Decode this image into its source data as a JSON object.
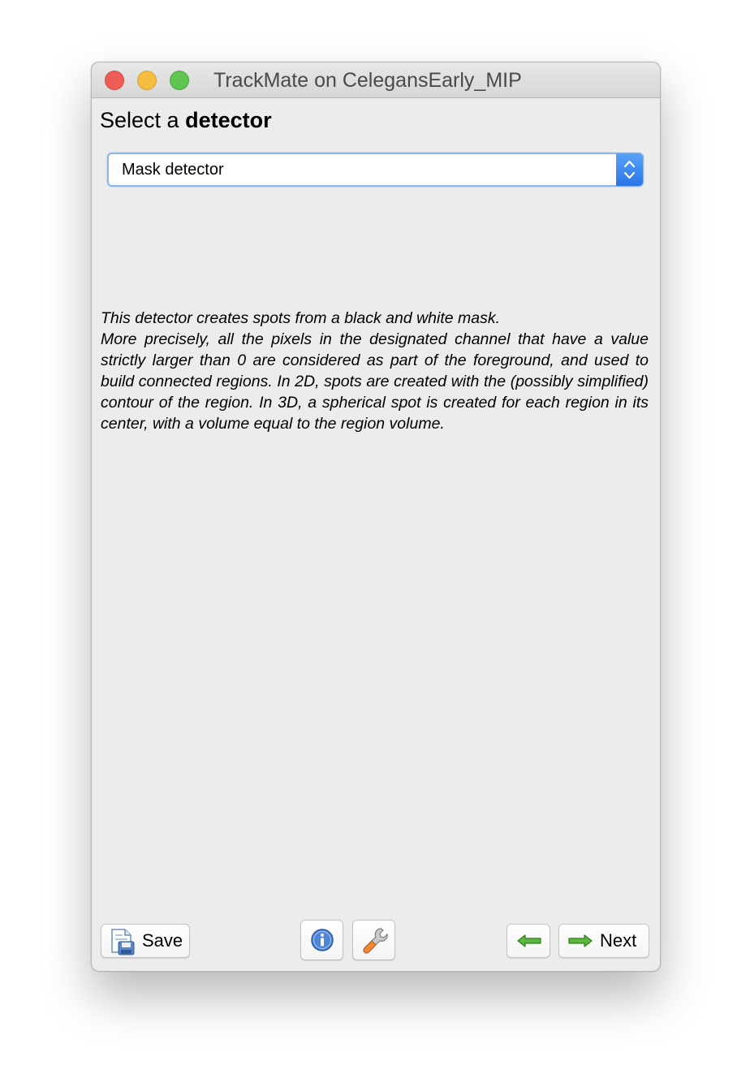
{
  "window": {
    "title": "TrackMate on CelegansEarly_MIP"
  },
  "heading": {
    "prefix": "Select a",
    "emphasis": "detector"
  },
  "detector_select": {
    "selected": "Mask detector"
  },
  "description": {
    "lines": [
      "This detector creates spots from a black and white mask.",
      "More precisely, all the pixels in the designated channel that have a value strictly larger than 0 are considered as part of the foreground, and used to build connected regions. In 2D, spots are created with the (possibly simplified) contour of the region. In 3D, a spherical spot is created for each region in its center, with a volume equal to the region volume."
    ]
  },
  "footer": {
    "save_label": "Save",
    "next_label": "Next",
    "icons": {
      "save": "save-icon",
      "info": "info-icon",
      "settings": "wrench-icon",
      "previous": "left-arrow-icon",
      "next": "right-arrow-icon"
    }
  },
  "colors": {
    "window_bg": "#ececec",
    "select_accent": "#2a74e6",
    "close": "#ee5d55",
    "minimize": "#f4bd3f",
    "maximize": "#5fc551"
  }
}
